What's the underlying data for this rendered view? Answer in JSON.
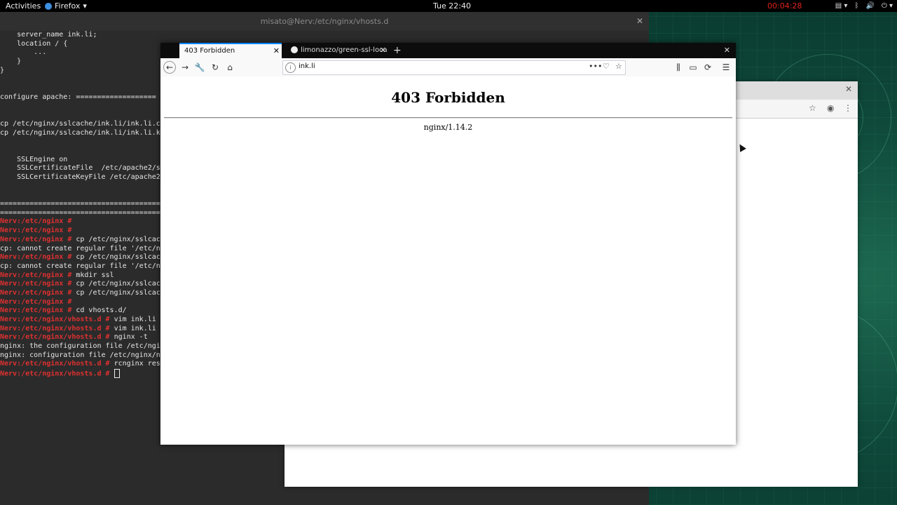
{
  "topbar": {
    "activities": "Activities",
    "app_name": "Firefox",
    "clock": "Tue 22:40",
    "recording": "00:04:28",
    "icons": [
      "clipboard-icon",
      "bluetooth-icon",
      "volume-icon",
      "power-icon"
    ]
  },
  "terminal": {
    "title": "misato@Nerv:/etc/nginx/vhosts.d",
    "lines": [
      {
        "text": "    server_name ink.li;"
      },
      {
        "text": "    location / {"
      },
      {
        "text": "        ..."
      },
      {
        "text": "    }"
      },
      {
        "text": "}"
      },
      {
        "text": ""
      },
      {
        "text": ""
      },
      {
        "text": "configure apache: ==================="
      },
      {
        "text": ""
      },
      {
        "text": ""
      },
      {
        "text": "cp /etc/nginx/sslcache/ink.li/ink.li.c"
      },
      {
        "text": "cp /etc/nginx/sslcache/ink.li/ink.li.k"
      },
      {
        "text": ""
      },
      {
        "text": ""
      },
      {
        "text": "    SSLEngine on"
      },
      {
        "text": "    SSLCertificateFile  /etc/apache2/s"
      },
      {
        "text": "    SSLCertificateKeyFile /etc/apache2"
      },
      {
        "text": ""
      },
      {
        "text": ""
      },
      {
        "text": "======================================"
      },
      {
        "text": "======================================"
      },
      {
        "prompt": "Nerv:/etc/nginx # ",
        "text": ""
      },
      {
        "prompt": "Nerv:/etc/nginx # ",
        "text": ""
      },
      {
        "prompt": "Nerv:/etc/nginx # ",
        "text": "cp /etc/nginx/sslcac"
      },
      {
        "text": "cp: cannot create regular file '/etc/n"
      },
      {
        "prompt": "Nerv:/etc/nginx # ",
        "text": "cp /etc/nginx/sslcac"
      },
      {
        "text": "cp: cannot create regular file '/etc/n"
      },
      {
        "prompt": "Nerv:/etc/nginx # ",
        "text": "mkdir ssl"
      },
      {
        "prompt": "Nerv:/etc/nginx # ",
        "text": "cp /etc/nginx/sslcac"
      },
      {
        "prompt": "Nerv:/etc/nginx # ",
        "text": "cp /etc/nginx/sslcac"
      },
      {
        "prompt": "Nerv:/etc/nginx # ",
        "text": ""
      },
      {
        "prompt": "Nerv:/etc/nginx # ",
        "text": "cd vhosts.d/"
      },
      {
        "prompt": "Nerv:/etc/nginx/vhosts.d # ",
        "text": "vim ink.li"
      },
      {
        "prompt": "Nerv:/etc/nginx/vhosts.d # ",
        "text": "vim ink.li"
      },
      {
        "prompt": "Nerv:/etc/nginx/vhosts.d # ",
        "text": "nginx -t"
      },
      {
        "text": "nginx: the configuration file /etc/ngi"
      },
      {
        "text": "nginx: configuration file /etc/nginx/n"
      },
      {
        "prompt": "Nerv:/etc/nginx/vhosts.d # ",
        "text": "rcnginx res"
      },
      {
        "prompt": "Nerv:/etc/nginx/vhosts.d # ",
        "text": "",
        "cursor": true
      }
    ]
  },
  "firefox": {
    "tabs": [
      {
        "label": "403 Forbidden",
        "active": true
      },
      {
        "label": "limonazzo/green-ssl-loca",
        "active": false
      }
    ],
    "new_tab": "+",
    "url": "ink.li",
    "page": {
      "heading": "403 Forbidden",
      "server": "nginx/1.14.2"
    }
  }
}
